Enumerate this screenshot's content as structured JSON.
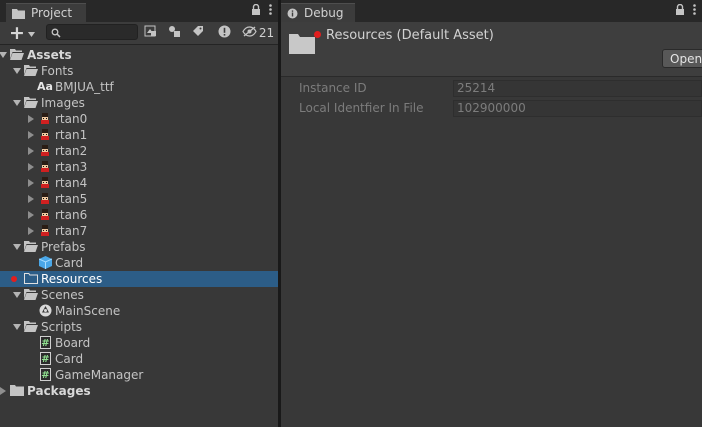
{
  "project_panel": {
    "tab_title": "Project",
    "tab_icon": "folder-icon",
    "toolbar": {
      "add_label": "+",
      "search_placeholder": "",
      "hidden_packages_count": "21"
    },
    "tree": [
      {
        "label": "Assets",
        "depth": 0,
        "expanded": true,
        "icon": "folder-open-icon",
        "bold": true
      },
      {
        "label": "Fonts",
        "depth": 1,
        "expanded": true,
        "icon": "folder-open-icon"
      },
      {
        "label": "BMJUA_ttf",
        "depth": 2,
        "icon": "font-icon",
        "icon_text": "Aa"
      },
      {
        "label": "Images",
        "depth": 1,
        "expanded": true,
        "icon": "folder-open-icon"
      },
      {
        "label": "rtan0",
        "depth": 2,
        "collapsed": true,
        "icon": "sprite-icon"
      },
      {
        "label": "rtan1",
        "depth": 2,
        "collapsed": true,
        "icon": "sprite-icon"
      },
      {
        "label": "rtan2",
        "depth": 2,
        "collapsed": true,
        "icon": "sprite-icon"
      },
      {
        "label": "rtan3",
        "depth": 2,
        "collapsed": true,
        "icon": "sprite-icon"
      },
      {
        "label": "rtan4",
        "depth": 2,
        "collapsed": true,
        "icon": "sprite-icon"
      },
      {
        "label": "rtan5",
        "depth": 2,
        "collapsed": true,
        "icon": "sprite-icon"
      },
      {
        "label": "rtan6",
        "depth": 2,
        "collapsed": true,
        "icon": "sprite-icon"
      },
      {
        "label": "rtan7",
        "depth": 2,
        "collapsed": true,
        "icon": "sprite-icon"
      },
      {
        "label": "Prefabs",
        "depth": 1,
        "expanded": true,
        "icon": "folder-open-icon"
      },
      {
        "label": "Card",
        "depth": 2,
        "icon": "prefab-icon"
      },
      {
        "label": "Resources",
        "depth": 1,
        "icon": "folder-empty-icon",
        "selected": true,
        "marker": true
      },
      {
        "label": "Scenes",
        "depth": 1,
        "expanded": true,
        "icon": "folder-open-icon"
      },
      {
        "label": "MainScene",
        "depth": 2,
        "icon": "scene-icon"
      },
      {
        "label": "Scripts",
        "depth": 1,
        "expanded": true,
        "icon": "folder-open-icon"
      },
      {
        "label": "Board",
        "depth": 2,
        "icon": "script-icon"
      },
      {
        "label": "Card",
        "depth": 2,
        "icon": "script-icon"
      },
      {
        "label": "GameManager",
        "depth": 2,
        "icon": "script-icon"
      },
      {
        "label": "Packages",
        "depth": 0,
        "collapsed": true,
        "icon": "folder-icon",
        "bold": true
      }
    ]
  },
  "debug_panel": {
    "tab_title": "Debug",
    "tab_icon": "info-icon",
    "asset_title": "Resources (Default Asset)",
    "open_button": "Open",
    "fields": [
      {
        "label": "Instance ID",
        "value": "25214"
      },
      {
        "label": "Local Identfier In File",
        "value": "102900000"
      }
    ]
  },
  "colors": {
    "selection": "#2c5d87",
    "panel": "#383838",
    "marker": "#e21e1e"
  }
}
